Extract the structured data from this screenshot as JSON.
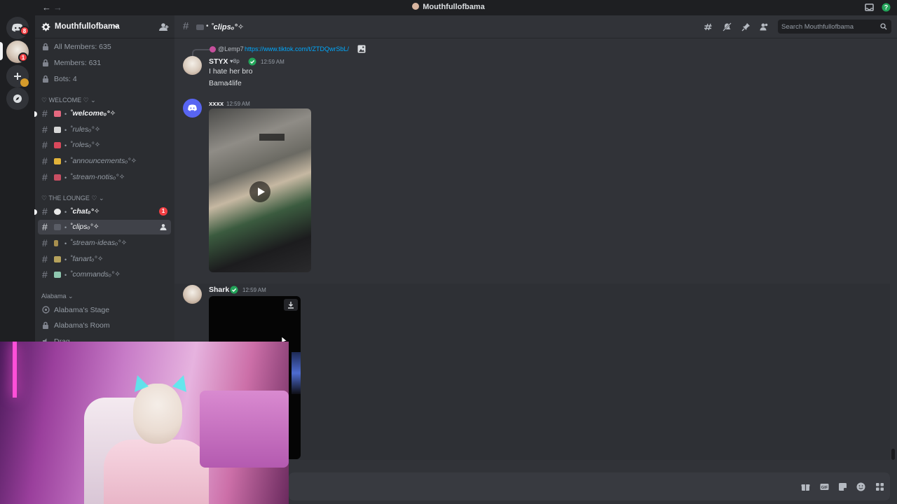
{
  "window": {
    "title": "Mouthfullofbama",
    "back_arrow": "←",
    "forward_arrow": "→"
  },
  "server_rail": {
    "discord_badge": "8",
    "server_badge": "1"
  },
  "server": {
    "name": "Mouthfullofbama"
  },
  "stats": [
    {
      "label": "All Members: 635"
    },
    {
      "label": "Members: 631"
    },
    {
      "label": "Bots: 4"
    }
  ],
  "categories": {
    "welcome": "♡ WELCOME ♡",
    "lounge": "♡ THE LOUNGE ♡",
    "alabama": "Alabama"
  },
  "channels": {
    "welcome": "˚welcomeₒ°✧",
    "rules": "˚rulesₒ°✧",
    "roles": "˚rolesₒ°✧",
    "announcements": "˚announcementsₒ°✧",
    "stream_notis": "˚stream-notisₒ°✧",
    "chat": "˚chatₒ°✧",
    "chat_badge": "1",
    "clips": "˚clipsₒ°✧",
    "stream_ideas": "˚stream-ideasₒ°✧",
    "fanart": "˚fanartₒ°✧",
    "commands": "˚commandsₒ°✧",
    "separator": "•"
  },
  "voice": {
    "stage": "Alabama's Stage",
    "room": "Alabama's Room",
    "partial": "Drag"
  },
  "chat_header": {
    "channel_name": "˚clipsₒ°✧",
    "search_placeholder": "Search Mouthfullofbama"
  },
  "messages": {
    "reply_author": "@Lemp7",
    "reply_link": "https://www.tiktok.com/t/ZTDQwrSbL/",
    "styx_name": "STYX",
    "styx_tag": "8p",
    "styx_time": "12:59 AM",
    "styx_line1": "I hate her bro",
    "styx_line2": "Bama4life",
    "xxxx_name": "xxxx",
    "xxxx_time": "12:59 AM",
    "shark_name": "Shark",
    "shark_time": "12:59 AM"
  },
  "colors": {
    "link": "#00a8fc",
    "badge_red": "#f23f43",
    "blurple": "#5865f2",
    "verified_green": "#23a55a"
  }
}
